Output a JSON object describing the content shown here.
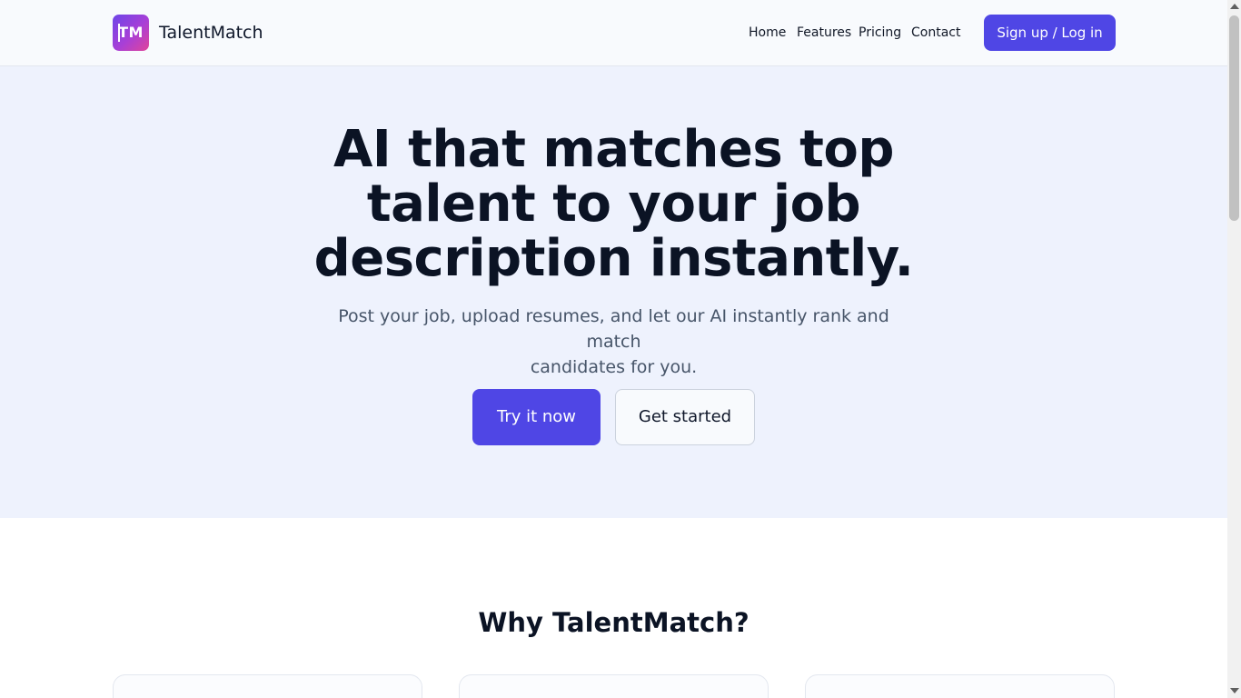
{
  "header": {
    "logo_text": "TM",
    "brand_name": "TalentMatch",
    "nav": [
      "Home",
      "Features",
      "Pricing",
      "Contact"
    ],
    "signup_label": "Sign up / Log in"
  },
  "hero": {
    "title_lines": [
      "AI that matches top",
      "talent to your job",
      "description instantly."
    ],
    "subtitle_lines": [
      "Post your job, upload resumes, and let our AI instantly rank and match",
      "candidates for you."
    ],
    "primary_cta": "Try it now",
    "secondary_cta": "Get started"
  },
  "why": {
    "title": "Why TalentMatch?"
  },
  "colors": {
    "accent": "#4f46e5",
    "hero_bg": "#eef2fd",
    "header_bg": "#f8fafd",
    "heading": "#0b1324",
    "subtext": "#475569"
  }
}
